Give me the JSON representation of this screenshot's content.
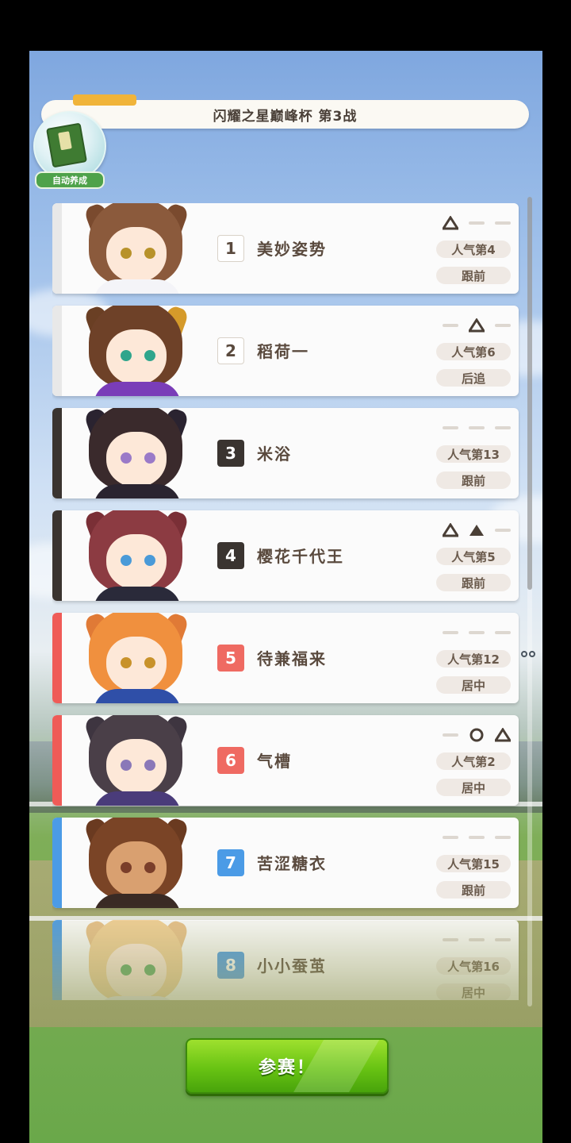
{
  "race_title": "闪耀之星巅峰杯  第3战",
  "auto_train": {
    "label": "自动养成",
    "icon": "book-icon"
  },
  "start_button": "参赛！",
  "colors": {
    "white_frame": "#e8e8e8",
    "black_frame": "#3a3430",
    "red_frame": "#ef5b57",
    "blue_frame": "#4b9be6",
    "button_green": "#68c313"
  },
  "entries": [
    {
      "gate": "1",
      "name": "美妙姿势",
      "popularity": "人气第4",
      "style": "跟前",
      "frame": "white",
      "marks": [
        "triangle",
        "none",
        "none"
      ]
    },
    {
      "gate": "2",
      "name": "稻荷一",
      "popularity": "人气第6",
      "style": "后追",
      "frame": "white",
      "marks": [
        "none",
        "triangle",
        "none"
      ]
    },
    {
      "gate": "3",
      "name": "米浴",
      "popularity": "人气第13",
      "style": "跟前",
      "frame": "black",
      "marks": [
        "none",
        "none",
        "none"
      ]
    },
    {
      "gate": "4",
      "name": "樱花千代王",
      "popularity": "人气第5",
      "style": "跟前",
      "frame": "black",
      "marks": [
        "triangle",
        "filled-triangle",
        "none"
      ]
    },
    {
      "gate": "5",
      "name": "待兼福来",
      "popularity": "人气第12",
      "style": "居中",
      "frame": "red",
      "marks": [
        "none",
        "none",
        "none"
      ]
    },
    {
      "gate": "6",
      "name": "气槽",
      "popularity": "人气第2",
      "style": "居中",
      "frame": "red",
      "marks": [
        "none",
        "circle",
        "triangle"
      ]
    },
    {
      "gate": "7",
      "name": "苦涩糖衣",
      "popularity": "人气第15",
      "style": "跟前",
      "frame": "blue",
      "marks": [
        "none",
        "none",
        "none"
      ]
    },
    {
      "gate": "8",
      "name": "小小蚕茧",
      "popularity": "人气第16",
      "style": "居中",
      "frame": "blue",
      "marks": [
        "none",
        "none",
        "none"
      ]
    }
  ]
}
